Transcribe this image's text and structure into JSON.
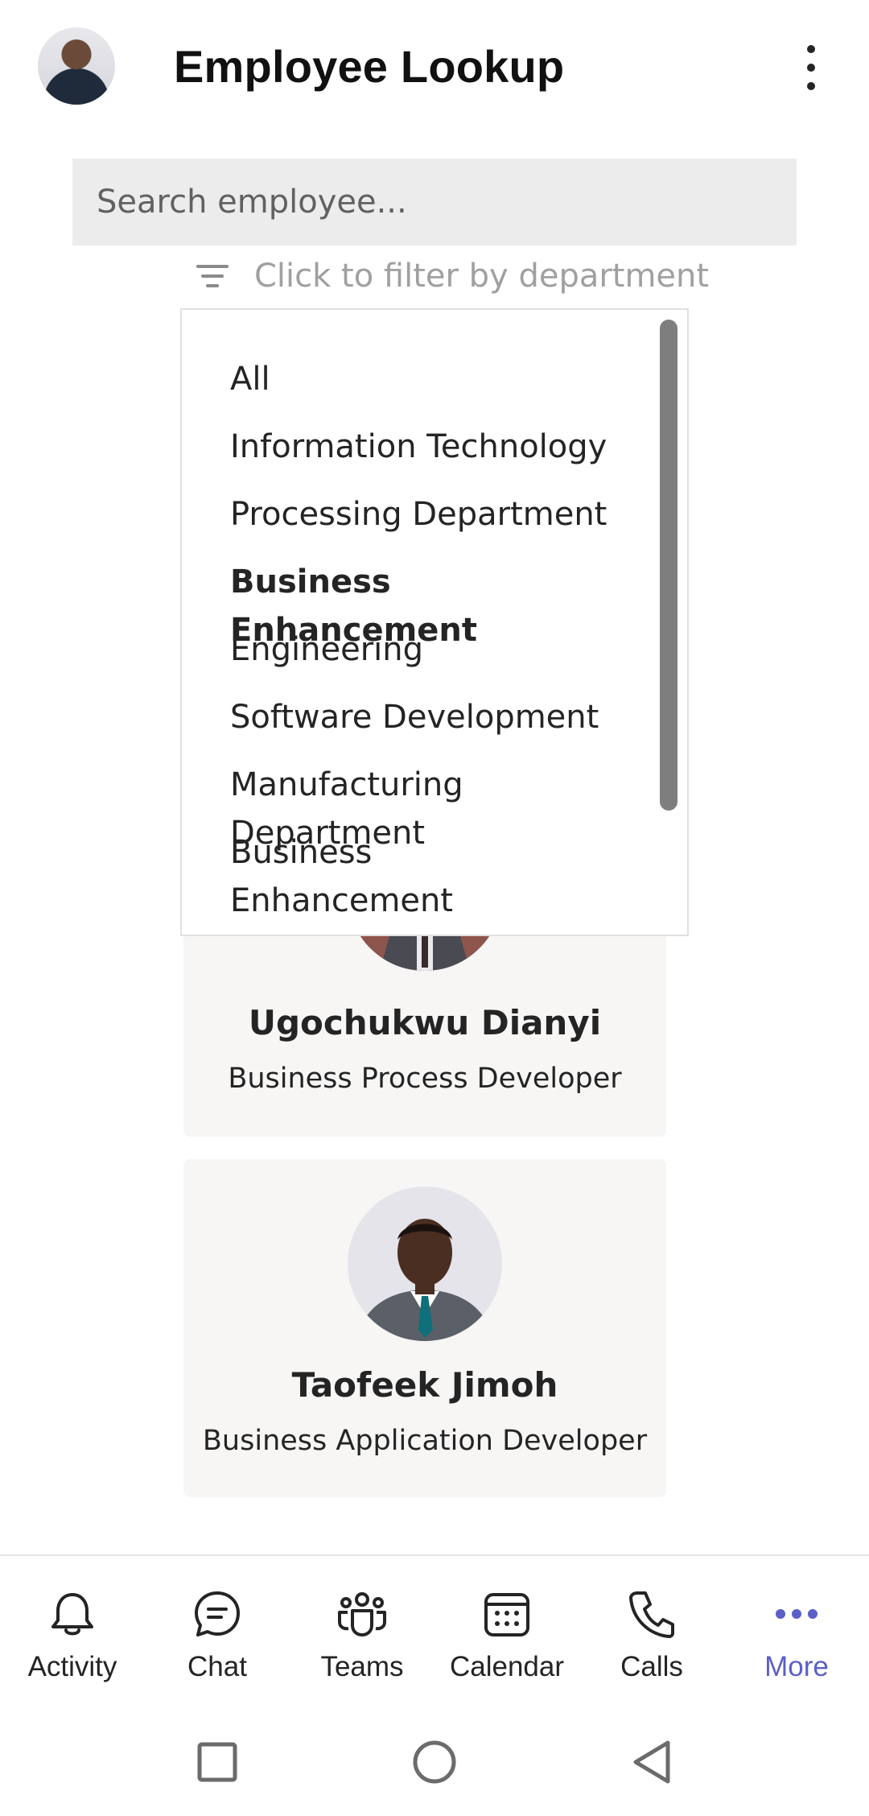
{
  "header": {
    "title": "Employee Lookup"
  },
  "search": {
    "placeholder": "Search employee..."
  },
  "filter": {
    "label": "Click to filter by department"
  },
  "dropdown": {
    "options": [
      "All",
      "Information Technology",
      "Processing Department",
      "Business Enhancement",
      "Engineering",
      "Software Development",
      "Manufacturing Department",
      "Business Enhancement Department"
    ],
    "selected": "Business Enhancement"
  },
  "employees": [
    {
      "name": "Ugochukwu Dianyi",
      "role": "Business Process Developer"
    },
    {
      "name": "Taofeek Jimoh",
      "role": "Business Application Developer"
    }
  ],
  "bottom_nav": {
    "items": [
      {
        "label": "Activity",
        "icon": "bell-icon"
      },
      {
        "label": "Chat",
        "icon": "chat-icon"
      },
      {
        "label": "Teams",
        "icon": "teams-icon"
      },
      {
        "label": "Calendar",
        "icon": "calendar-icon"
      },
      {
        "label": "Calls",
        "icon": "phone-icon"
      },
      {
        "label": "More",
        "icon": "more-icon"
      }
    ],
    "active": "More"
  },
  "colors": {
    "accent": "#5b5fc7",
    "search_bg": "#ececec",
    "card_bg": "#f7f6f5"
  }
}
